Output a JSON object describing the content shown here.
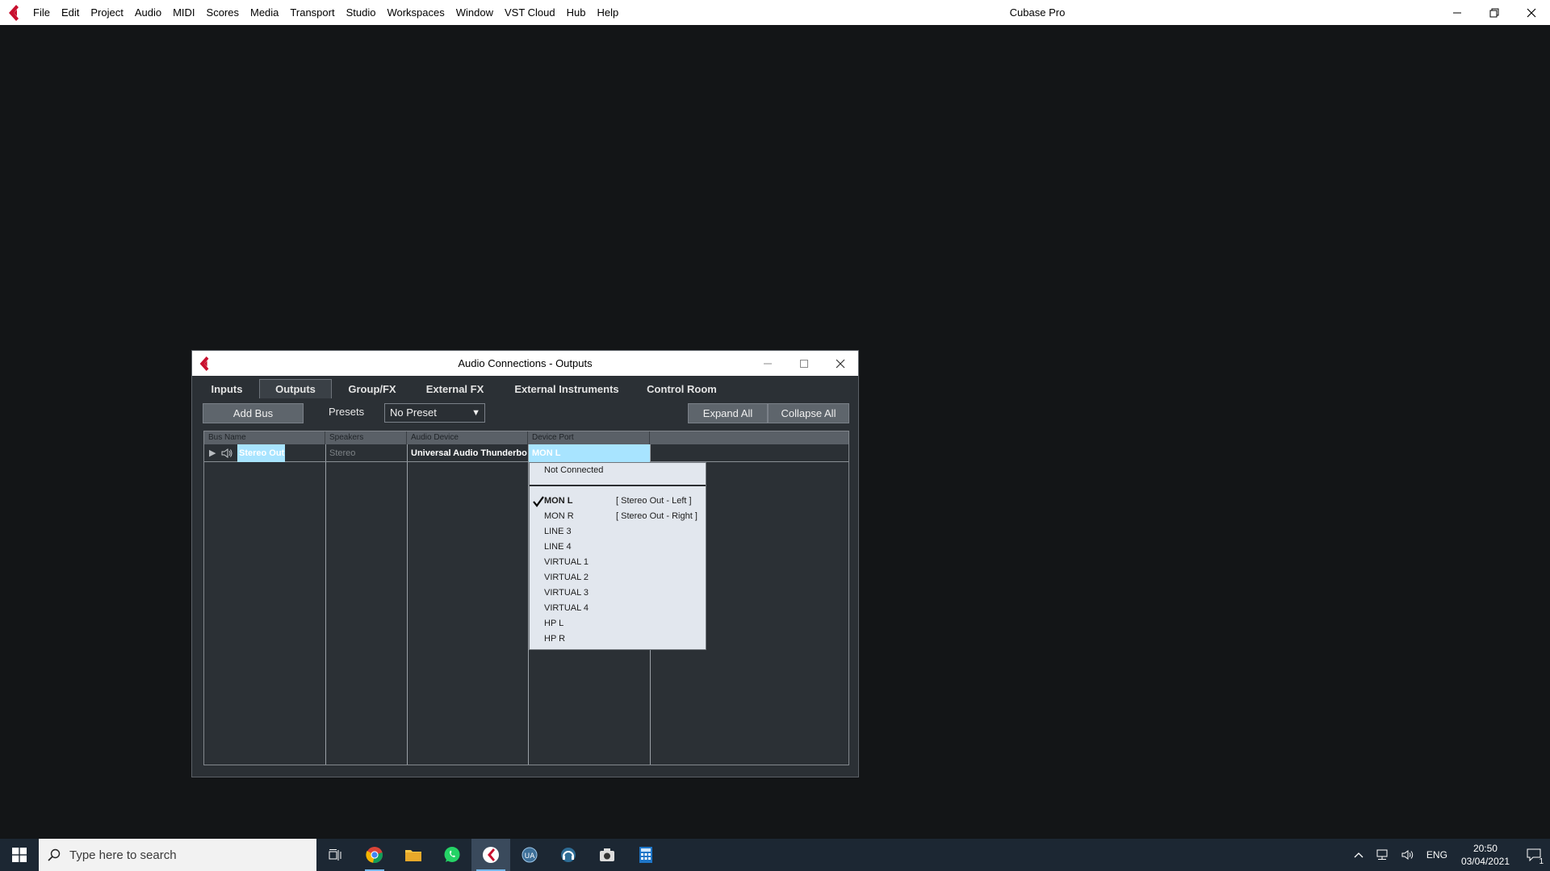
{
  "app": {
    "title": "Cubase Pro",
    "menu": [
      "File",
      "Edit",
      "Project",
      "Audio",
      "MIDI",
      "Scores",
      "Media",
      "Transport",
      "Studio",
      "Workspaces",
      "Window",
      "VST Cloud",
      "Hub",
      "Help"
    ]
  },
  "dialog": {
    "title": "Audio Connections - Outputs",
    "tabs": [
      "Inputs",
      "Outputs",
      "Group/FX",
      "External FX",
      "External Instruments",
      "Control Room"
    ],
    "active_tab": "Outputs",
    "toolbar": {
      "add_bus": "Add Bus",
      "presets_label": "Presets",
      "preset_value": "No Preset",
      "expand_all": "Expand All",
      "collapse_all": "Collapse All"
    },
    "columns": [
      "Bus Name",
      "Speakers",
      "Audio Device",
      "Device Port"
    ],
    "rows": [
      {
        "bus_name": "Stereo Out",
        "speakers": "Stereo",
        "audio_device": "Universal Audio Thunderbol",
        "device_port": "MON L"
      }
    ],
    "port_menu": {
      "not_connected": "Not Connected",
      "items": [
        {
          "label": "MON L",
          "assignment": "[ Stereo Out - Left ]",
          "checked": true
        },
        {
          "label": "MON R",
          "assignment": "[ Stereo Out - Right ]",
          "checked": false
        },
        {
          "label": "LINE 3",
          "assignment": "",
          "checked": false
        },
        {
          "label": "LINE 4",
          "assignment": "",
          "checked": false
        },
        {
          "label": "VIRTUAL 1",
          "assignment": "",
          "checked": false
        },
        {
          "label": "VIRTUAL 2",
          "assignment": "",
          "checked": false
        },
        {
          "label": "VIRTUAL 3",
          "assignment": "",
          "checked": false
        },
        {
          "label": "VIRTUAL 4",
          "assignment": "",
          "checked": false
        },
        {
          "label": "HP L",
          "assignment": "",
          "checked": false
        },
        {
          "label": "HP R",
          "assignment": "",
          "checked": false
        }
      ]
    }
  },
  "taskbar": {
    "search_placeholder": "Type here to search",
    "apps": [
      "task-view-icon",
      "chrome-icon",
      "file-explorer-icon",
      "whatsapp-icon",
      "cubase-icon",
      "audio-app-icon",
      "headset-app-icon",
      "camera-app-icon",
      "calculator-icon"
    ],
    "language": "ENG",
    "time": "20:50",
    "date": "03/04/2021",
    "notification_count": "1"
  },
  "colors": {
    "accent": "#c8102e",
    "selection": "#a8e4ff",
    "background": "#131517",
    "taskbar": "#1c2733"
  }
}
